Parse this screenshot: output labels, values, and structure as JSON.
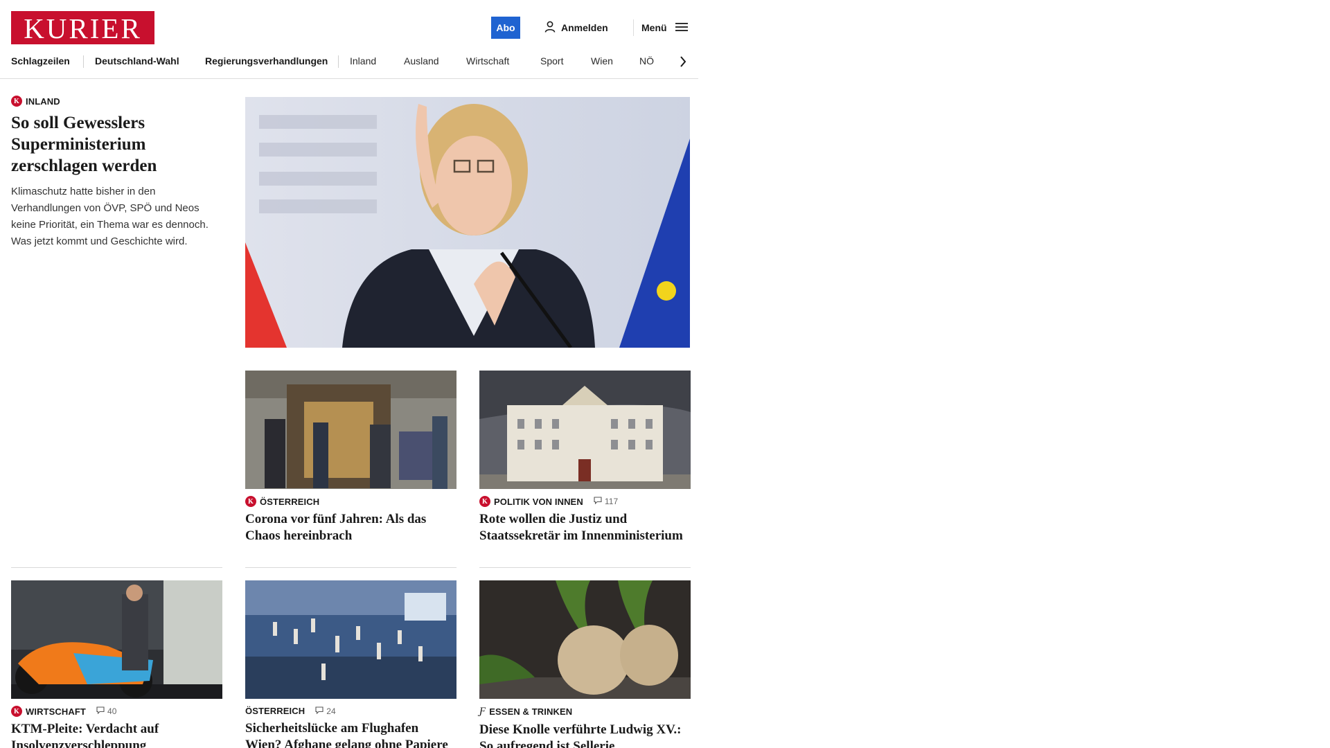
{
  "header": {
    "logo": "KURIER",
    "abo_label": "Abo",
    "login_label": "Anmelden",
    "menu_label": "Menü"
  },
  "nav": {
    "items": [
      "Schlagzeilen",
      "Deutschland-Wahl",
      "Regierungsverhandlungen",
      "Inland",
      "Ausland",
      "Wirtschaft",
      "Sport",
      "Wien",
      "NÖ"
    ]
  },
  "lead": {
    "category": "INLAND",
    "title": "So soll Gewesslers Superministerium zerschlagen werden",
    "teaser": "Klimaschutz hatte bisher in den Verhandlungen von ÖVP, SPÖ und Neos keine Priorität, ein Thema war es dennoch. Was jetzt kommt und Geschichte wird."
  },
  "articles": [
    {
      "category": "ÖSTERREICH",
      "comments": "",
      "title": "Corona vor fünf Jahren: Als das Chaos hereinbrach"
    },
    {
      "category": "POLITIK VON INNEN",
      "comments": "117",
      "title": "Rote wollen die Justiz und Staatssekretär im Innenministerium"
    },
    {
      "category": "WIRTSCHAFT",
      "comments": "40",
      "title": "KTM-Pleite: Verdacht auf Insolvenzverschleppung"
    },
    {
      "category": "ÖSTERREICH",
      "comments": "24",
      "title": "Sicherheitslücke am Flughafen Wien? Afghane gelang ohne Papiere in Flugzeug"
    },
    {
      "category": "ESSEN & TRINKEN",
      "comments": "",
      "title": "Diese Knolle verführte Ludwig XV.: So aufregend ist Sellerie"
    }
  ],
  "colors": {
    "brand": "#c8102e",
    "abo": "#1f63d1"
  }
}
